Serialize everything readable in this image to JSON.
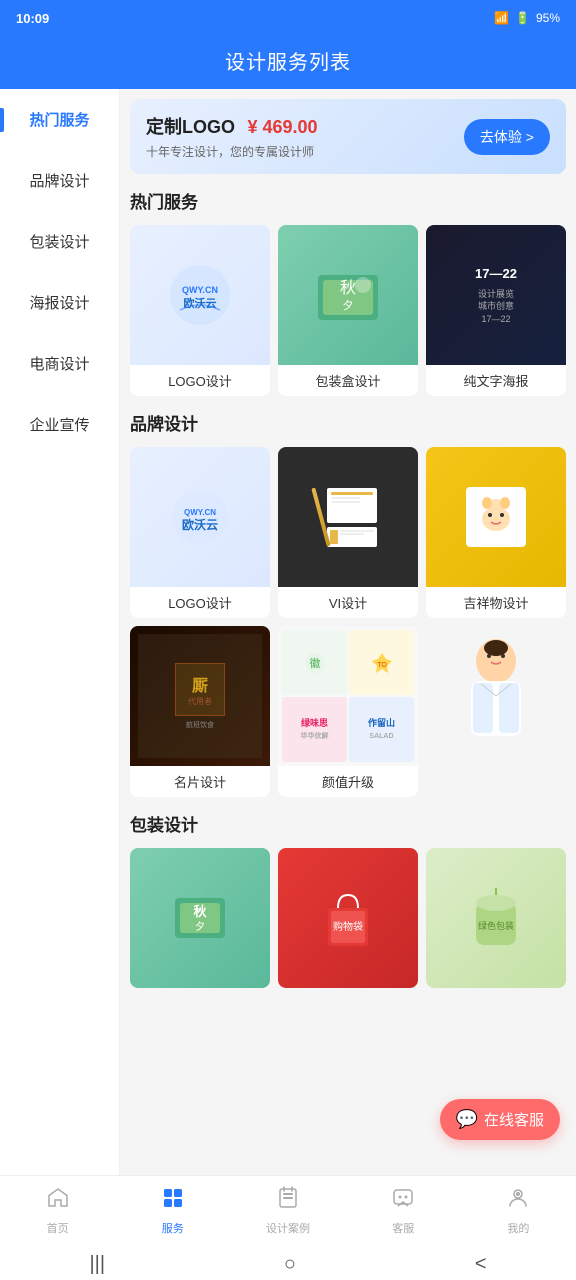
{
  "statusBar": {
    "time": "10:09",
    "battery": "95%"
  },
  "header": {
    "title": "设计服务列表"
  },
  "sidebar": {
    "items": [
      {
        "id": "hot",
        "label": "热门服务",
        "active": true
      },
      {
        "id": "brand",
        "label": "品牌设计",
        "active": false
      },
      {
        "id": "package",
        "label": "包装设计",
        "active": false
      },
      {
        "id": "poster",
        "label": "海报设计",
        "active": false
      },
      {
        "id": "ecommerce",
        "label": "电商设计",
        "active": false
      },
      {
        "id": "enterprise",
        "label": "企业宣传",
        "active": false
      }
    ]
  },
  "banner": {
    "title": "定制LOGO",
    "price": "¥ 469.00",
    "subtitle": "十年专注设计，您的专属设计师",
    "btnLabel": "去体验 >"
  },
  "sections": [
    {
      "id": "hot",
      "title": "热门服务",
      "items": [
        {
          "label": "LOGO设计"
        },
        {
          "label": "包装盒设计"
        },
        {
          "label": "纯文字海报"
        }
      ]
    },
    {
      "id": "brand",
      "title": "品牌设计",
      "row1": [
        {
          "label": "LOGO设计"
        },
        {
          "label": "VI设计"
        },
        {
          "label": "吉祥物设计"
        }
      ],
      "row2": [
        {
          "label": "名片设计"
        },
        {
          "label": "颜值升级"
        }
      ]
    },
    {
      "id": "package",
      "title": "包装设计",
      "items": [
        {
          "label": ""
        },
        {
          "label": ""
        },
        {
          "label": ""
        }
      ]
    }
  ],
  "floatBtn": {
    "label": "在线客服"
  },
  "bottomNav": {
    "items": [
      {
        "id": "home",
        "label": "首页",
        "icon": "⌂",
        "active": false
      },
      {
        "id": "service",
        "label": "服务",
        "icon": "❖",
        "active": true
      },
      {
        "id": "cases",
        "label": "设计案例",
        "icon": "◱",
        "active": false
      },
      {
        "id": "customer",
        "label": "客服",
        "icon": "💬",
        "active": false
      },
      {
        "id": "mine",
        "label": "我的",
        "icon": "☺",
        "active": false
      }
    ]
  },
  "homeIndicator": {
    "left": "|||",
    "middle": "○",
    "right": "<"
  }
}
